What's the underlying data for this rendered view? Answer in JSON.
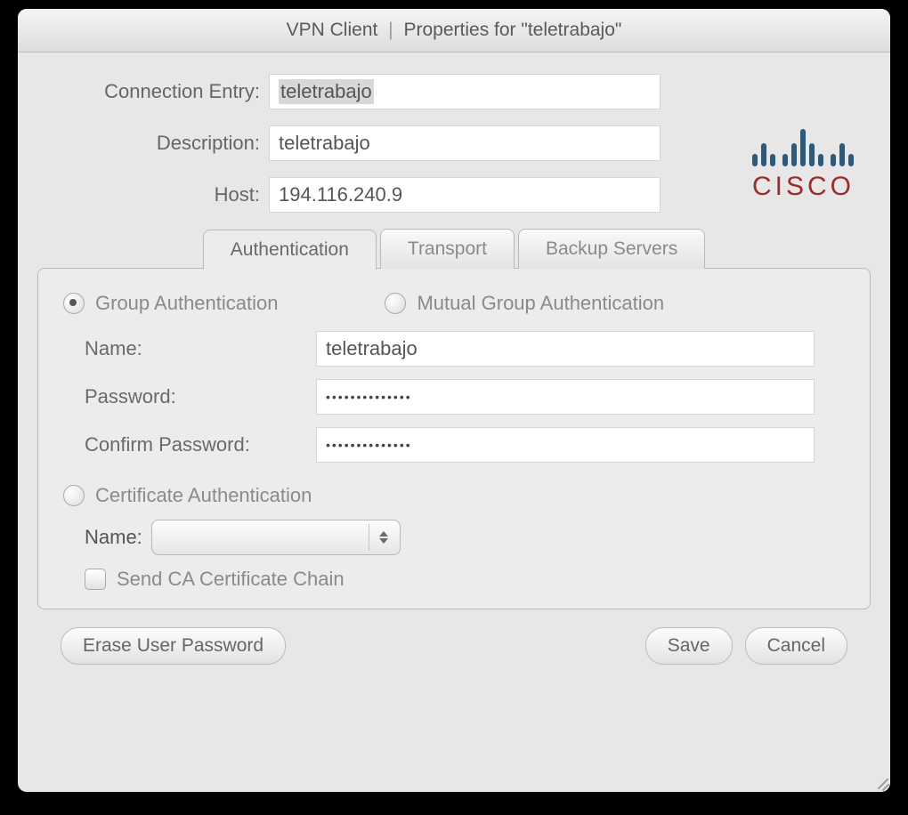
{
  "title": {
    "app": "VPN Client",
    "sep": "|",
    "props": "Properties for \"teletrabajo\""
  },
  "logo": "CISCO",
  "fields": {
    "connection_entry_label": "Connection Entry:",
    "connection_entry_value": "teletrabajo",
    "description_label": "Description:",
    "description_value": "teletrabajo",
    "host_label": "Host:",
    "host_value": "194.116.240.9"
  },
  "tabs": [
    "Authentication",
    "Transport",
    "Backup Servers"
  ],
  "auth": {
    "group_label": "Group Authentication",
    "mutual_label": "Mutual Group Authentication",
    "name_label": "Name:",
    "name_value": "teletrabajo",
    "pw_label": "Password:",
    "pw_value": "••••••••••••••",
    "cpw_label": "Confirm Password:",
    "cpw_value": "••••••••••••••",
    "cert_label": "Certificate Authentication",
    "cert_name_label": "Name:",
    "cert_name_value": "",
    "ca_chain_label": "Send CA Certificate Chain"
  },
  "buttons": {
    "erase": "Erase User Password",
    "save": "Save",
    "cancel": "Cancel"
  }
}
